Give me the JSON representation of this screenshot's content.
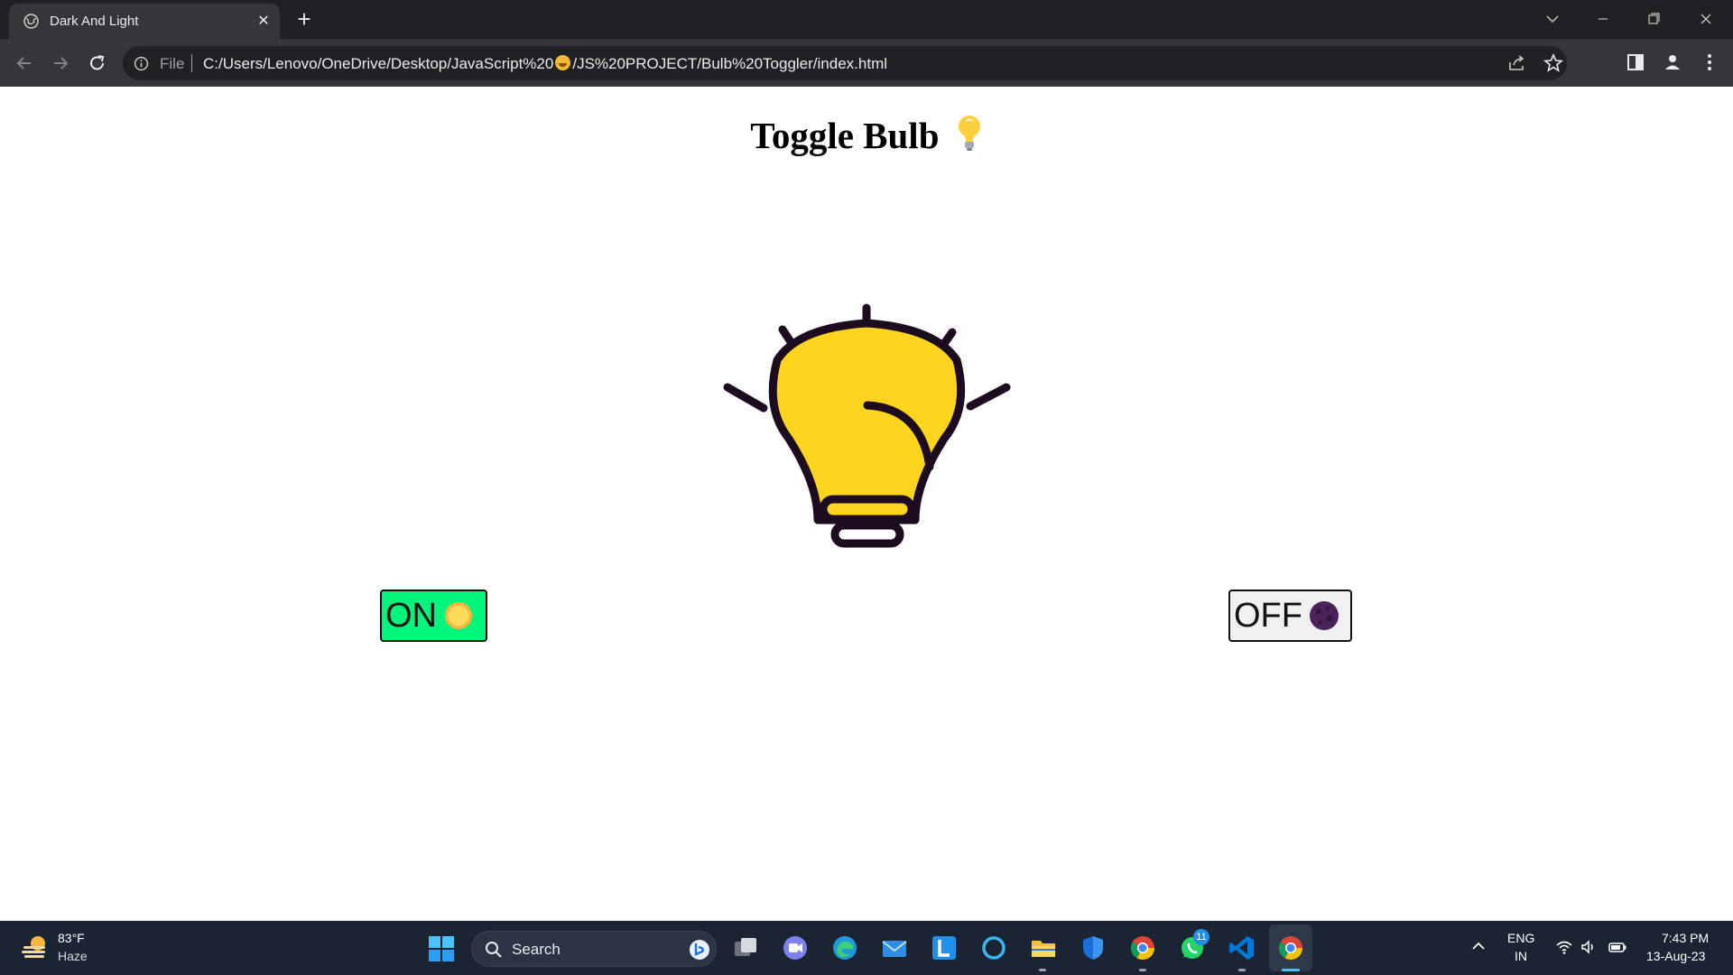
{
  "browser": {
    "tab_title": "Dark And Light",
    "omnibox_scheme": "File",
    "url_part1": "C:/Users/Lenovo/OneDrive/Desktop/JavaScript%20",
    "url_part2": "/JS%20PROJECT/Bulb%20Toggler/index.html"
  },
  "page": {
    "title": "Toggle Bulb",
    "on_button_label": "ON",
    "off_button_label": "OFF"
  },
  "colors": {
    "bulb_fill": "#fed51e",
    "bulb_outline": "#1d0c1f",
    "on_button_bg": "#00f57a",
    "off_button_bg": "#f0f0f0"
  },
  "taskbar": {
    "weather_temp": "83°F",
    "weather_condition": "Haze",
    "search_label": "Search",
    "whatsapp_badge": "11",
    "lang_line1": "ENG",
    "lang_line2": "IN",
    "time": "7:43 PM",
    "date": "13-Aug-23"
  }
}
